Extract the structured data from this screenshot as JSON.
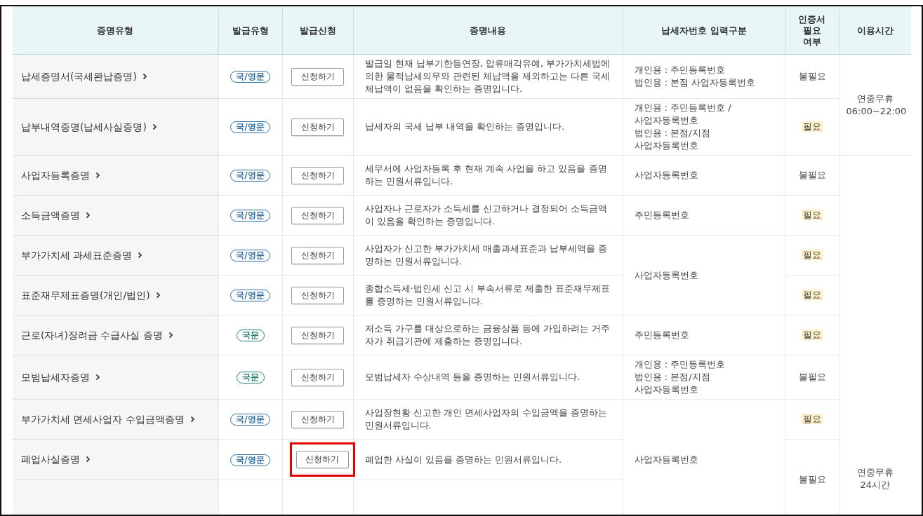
{
  "columns": [
    "증명유형",
    "발급유형",
    "발급신청",
    "증명내용",
    "납세자번호 입력구분",
    "인증서 필요 여부",
    "이용시간"
  ],
  "rows": [
    {
      "kind": "full",
      "name": "납세증명서(국세완납증명)",
      "issue_type": {
        "label": "국/영문",
        "color": "#2f6f9f"
      },
      "apply": "신청하기",
      "outlined": false,
      "description": "발급일 현재 납부기한등연장, 압류매각유예, 부가가치세법에 의한 물적납세의무와 관련된 체납액을 제외하고는 다른 국세 체납액이 없음을 확인하는 증명입니다.",
      "taxpayer_id": [
        "개인용 : 주민등록번호",
        "법인용 : 본점 사업자등록번호"
      ],
      "certificate": {
        "text": "불필요",
        "highlighted": false
      },
      "hours": [
        "연중무휴",
        "06:00~22:00"
      ]
    },
    {
      "kind": "full",
      "name": "납부내역증명(납세사실증명)",
      "issue_type": {
        "label": "국/영문",
        "color": "#2f6f9f"
      },
      "apply": "신청하기",
      "outlined": false,
      "description": "납세자의 국세 납부 내역을 확인하는 증명입니다.",
      "taxpayer_id": [
        "개인용 : 주민등록번호 /",
        "사업자등록번호",
        "법인용 : 본점/지점",
        "사업자등록번호"
      ],
      "certificate": {
        "text": "필요",
        "highlighted": true
      }
    },
    {
      "kind": "full",
      "name": "사업자등록증명",
      "issue_type": {
        "label": "국/영문",
        "color": "#2f6f9f"
      },
      "apply": "신청하기",
      "outlined": false,
      "description": "세무서에 사업자등록 후 현재 계속 사업을 하고 있음을 증명하는 민원서류입니다.",
      "taxpayer_id": [
        "사업자등록번호"
      ],
      "certificate": {
        "text": "불필요",
        "highlighted": false
      },
      "hours": [
        "연중무휴",
        "24시간"
      ]
    },
    {
      "kind": "full",
      "name": "소득금액증명",
      "issue_type": {
        "label": "국/영문",
        "color": "#2f6f9f"
      },
      "apply": "신청하기",
      "outlined": false,
      "description": "사업자나 근로자가 소득세를 신고하거나 결정되어 소득금액이 있음을 확인하는 증명입니다.",
      "taxpayer_id": [
        "주민등록번호"
      ],
      "certificate": {
        "text": "필요",
        "highlighted": true
      }
    },
    {
      "kind": "full",
      "name": "부가가치세 과세표준증명",
      "issue_type": {
        "label": "국/영문",
        "color": "#2f6f9f"
      },
      "apply": "신청하기",
      "outlined": false,
      "description": "사업자가 신고한 부가가치세 매출과세표준과 납부세액을 증명하는 민원서류입니다.",
      "taxpayer_id": [
        "사업자등록번호"
      ],
      "certificate": {
        "text": "필요",
        "highlighted": true
      }
    },
    {
      "kind": "full",
      "name": "표준재무제표증명(개인/법인)",
      "issue_type": {
        "label": "국/영문",
        "color": "#2f6f9f"
      },
      "apply": "신청하기",
      "outlined": false,
      "description": "종합소득세·법인세 신고 시 부속서류로 제출한 표준재무제표를 증명하는 민원서류입니다.",
      "certificate": {
        "text": "필요",
        "highlighted": true
      }
    },
    {
      "kind": "full",
      "name": "근로(자녀)장려금 수급사실 증명",
      "issue_type": {
        "label": "국문",
        "color": "#23806f"
      },
      "apply": "신청하기",
      "outlined": false,
      "description": "저소득 가구를 대상으로하는 금융상품 등에 가입하려는 거주자가 취급기관에 제출하는 증명입니다.",
      "taxpayer_id": [
        "주민등록번호"
      ],
      "certificate": {
        "text": "필요",
        "highlighted": true
      }
    },
    {
      "kind": "full",
      "name": "모범납세자증명",
      "issue_type": {
        "label": "국문",
        "color": "#23806f"
      },
      "apply": "신청하기",
      "outlined": false,
      "description": "모범납세자 수상내역 등을 증명하는 민원서류입니다.",
      "taxpayer_id": [
        "개인용 : 주민등록번호",
        "법인용 : 본점/지점",
        "사업자등록번호"
      ],
      "certificate": {
        "text": "불필요",
        "highlighted": false
      }
    },
    {
      "kind": "full",
      "name": "부가가치세 면세사업자 수입금액증명",
      "issue_type": {
        "label": "국/영문",
        "color": "#2f6f9f"
      },
      "apply": "신청하기",
      "outlined": false,
      "description": "사업장현황 신고한 개인 면세사업자의 수입금액을 증명하는 민원서류입니다.",
      "taxpayer_id": [
        "사업자등록번호"
      ],
      "certificate": {
        "text": "필요",
        "highlighted": true
      }
    },
    {
      "kind": "full",
      "name": "폐업사실증명",
      "issue_type": {
        "label": "국/영문",
        "color": "#2f6f9f"
      },
      "apply": "신청하기",
      "outlined": true,
      "description": "폐업한 사실이 있음을 증명하는 민원서류입니다.",
      "certificate": {
        "text": "불필요",
        "highlighted": false
      }
    },
    {
      "kind": "cut"
    }
  ]
}
